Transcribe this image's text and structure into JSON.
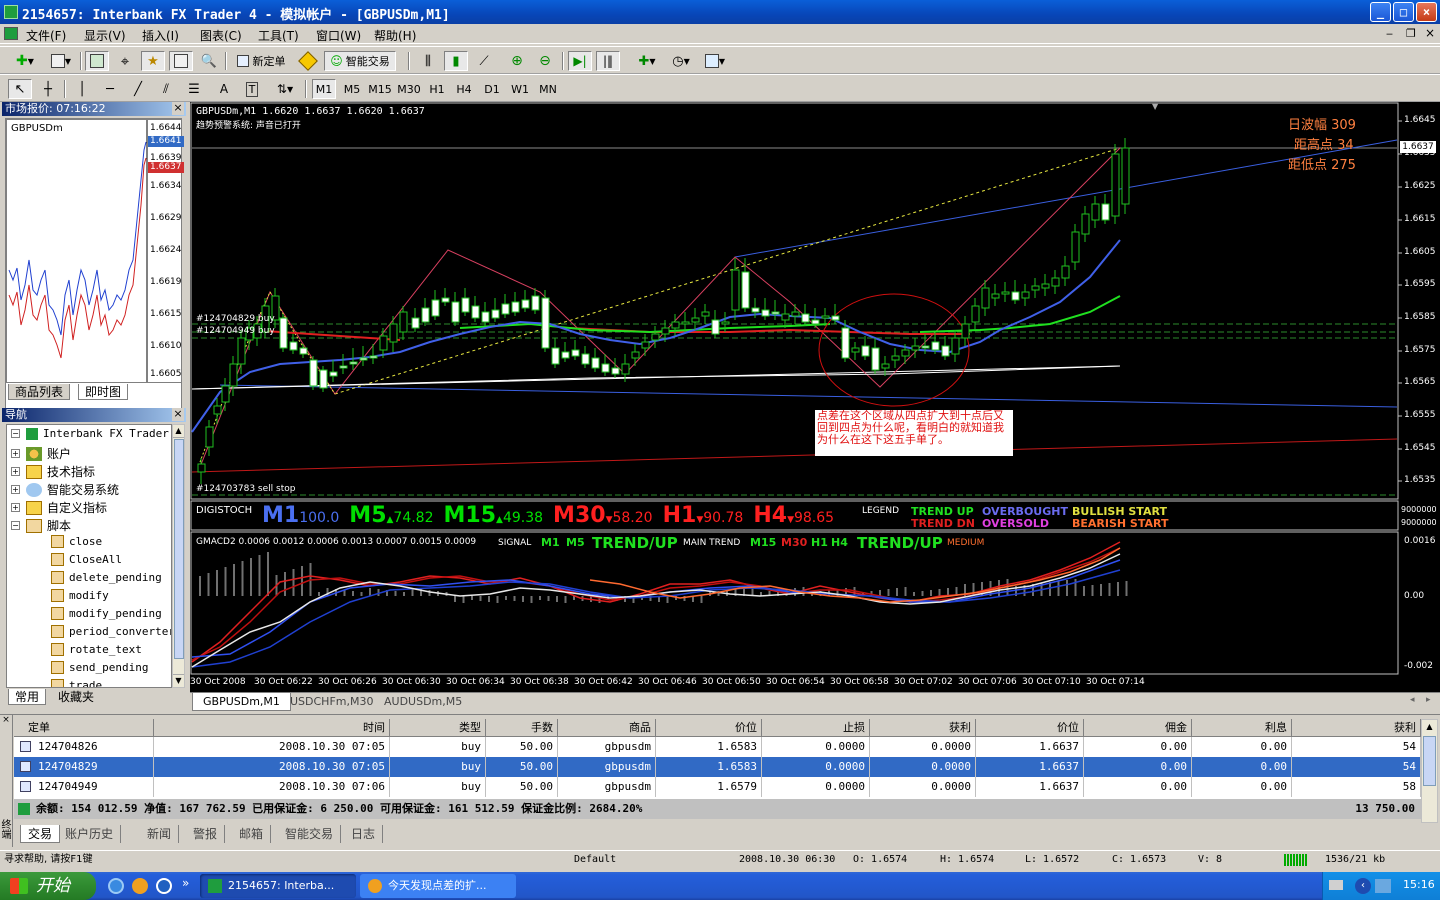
{
  "window": {
    "title": "2154657: Interbank FX Trader 4 - 模拟帐户 - [GBPUSDm,M1]",
    "buttons": [
      "_",
      "□",
      "×"
    ]
  },
  "menu": [
    "文件(F)",
    "显示(V)",
    "插入(I)",
    "图表(C)",
    "工具(T)",
    "窗口(W)",
    "帮助(H)"
  ],
  "toolbar1": {
    "new_order": "新定单",
    "expert_advisors": "智能交易"
  },
  "toolbar2": {
    "text_tool": "A",
    "timeframes": [
      "M1",
      "M5",
      "M15",
      "M30",
      "H1",
      "H4",
      "D1",
      "W1",
      "MN"
    ]
  },
  "market_watch": {
    "title": "市场报价: 07:16:22",
    "symbol": "GBPUSDm",
    "prices": [
      "1.6644",
      "1.6641",
      "1.6639",
      "1.6637",
      "1.6634",
      "1.6629",
      "1.6624",
      "1.6619",
      "1.6615",
      "1.6610",
      "1.6605"
    ],
    "tabs": [
      "商品列表",
      "即时图"
    ]
  },
  "navigator": {
    "title": "导航",
    "root": "Interbank FX Trader 4",
    "items": [
      "账户",
      "技术指标",
      "智能交易系统",
      "自定义指标",
      "脚本"
    ],
    "scripts": [
      "close",
      "CloseAll",
      "delete_pending",
      "modify",
      "modify_pending",
      "period_converter",
      "rotate_text",
      "send_pending",
      "trade"
    ],
    "tabs": [
      "常用",
      "收藏夹"
    ]
  },
  "chart": {
    "header": "GBPUSDm,M1  1.6620 1.6637 1.6620 1.6637",
    "subheader": "趋势预警系统: 声音已打开",
    "stats": [
      "日波幅 309",
      "距高点 34",
      "距低点 275"
    ],
    "current_price": "1.6637",
    "order_labels": [
      "#124704829 buy",
      "#124704949 buy",
      "#124703783 sell stop"
    ],
    "annotation": "点差在这个区域从四点扩大到十点后又回到四点为什么呢，看明白的就知道我为什么在这下这五手单了。",
    "price_axis": [
      "1.6645",
      "1.6635",
      "1.6625",
      "1.6615",
      "1.6605",
      "1.6595",
      "1.6585",
      "1.6575",
      "1.6565",
      "1.6555",
      "1.6545",
      "1.6535"
    ],
    "digistoch": {
      "label": "DIGISTOCH",
      "items": [
        {
          "tf": "M1",
          "val": "100.0",
          "arrow": "",
          "color": "#4a6ff0"
        },
        {
          "tf": "M5",
          "val": "74.82",
          "arrow": "▲",
          "color": "#00e000"
        },
        {
          "tf": "M15",
          "val": "49.38",
          "arrow": "▲",
          "color": "#00e000"
        },
        {
          "tf": "M30",
          "val": "58.20",
          "arrow": "▼",
          "color": "#ff2020"
        },
        {
          "tf": "H1",
          "val": "90.78",
          "arrow": "▼",
          "color": "#ff2020"
        },
        {
          "tf": "H4",
          "val": "98.65",
          "arrow": "▼",
          "color": "#ff2020"
        }
      ],
      "legend": "LEGEND",
      "legend_items": [
        "TREND UP",
        "TREND DN",
        "OVERBOUGHT",
        "OVERSOLD",
        "BULLISH START",
        "BEARISH START"
      ],
      "axis": [
        "9000000",
        "9000000"
      ]
    },
    "gmacd": {
      "label": "GMACD2 0.0006 0.0012 0.0006 0.0013 0.0007 0.0015 0.0009",
      "signal": "SIGNAL",
      "signal_tfs": [
        "M1",
        "M5"
      ],
      "signal_trend": "TREND/UP",
      "main_trend": "MAIN TREND",
      "main_tfs": [
        "M15",
        "M30",
        "H1",
        "H4"
      ],
      "main_trend_val": "TREND/UP",
      "strength": "MEDIUM",
      "axis": [
        "0.0016",
        "0.00",
        "-0.002"
      ]
    },
    "time_axis": [
      "30 Oct 2008",
      "30 Oct 06:22",
      "30 Oct 06:26",
      "30 Oct 06:30",
      "30 Oct 06:34",
      "30 Oct 06:38",
      "30 Oct 06:42",
      "30 Oct 06:46",
      "30 Oct 06:50",
      "30 Oct 06:54",
      "30 Oct 06:58",
      "30 Oct 07:02",
      "30 Oct 07:06",
      "30 Oct 07:10",
      "30 Oct 07:14"
    ],
    "tabs": [
      "GBPUSDm,M1",
      "USDCHFm,M30",
      "AUDUSDm,M5"
    ]
  },
  "terminal": {
    "columns": [
      "定单",
      "时间",
      "类型",
      "手数",
      "商品",
      "价位",
      "止损",
      "获利",
      "价位",
      "佣金",
      "利息",
      "获利"
    ],
    "rows": [
      [
        "124704826",
        "2008.10.30 07:05",
        "buy",
        "50.00",
        "gbpusdm",
        "1.6583",
        "0.0000",
        "0.0000",
        "1.6637",
        "0.00",
        "0.00",
        "54"
      ],
      [
        "124704829",
        "2008.10.30 07:05",
        "buy",
        "50.00",
        "gbpusdm",
        "1.6583",
        "0.0000",
        "0.0000",
        "1.6637",
        "0.00",
        "0.00",
        "54"
      ],
      [
        "124704949",
        "2008.10.30 07:06",
        "buy",
        "50.00",
        "gbpusdm",
        "1.6579",
        "0.0000",
        "0.0000",
        "1.6637",
        "0.00",
        "0.00",
        "58"
      ]
    ],
    "summary": "余额: 154 012.59  净值: 167 762.59  已用保证金: 6 250.00  可用保证金: 161 512.59  保证金比例: 2684.20%",
    "summary_profit": "13 750.00",
    "side_label": "终端",
    "tabs": [
      "交易",
      "账户历史",
      "新闻",
      "警报",
      "邮箱",
      "智能交易",
      "日志"
    ]
  },
  "statusbar": {
    "help": "寻求帮助, 请按F1键",
    "profile": "Default",
    "time": "2008.10.30 06:30",
    "open": "O: 1.6574",
    "high": "H: 1.6574",
    "low": "L: 1.6572",
    "close": "C: 1.6573",
    "volume": "V: 8",
    "traffic": "1536/21 kb"
  },
  "taskbar": {
    "start": "开始",
    "tasks": [
      "2154657: Interba...",
      "今天发现点差的扩..."
    ],
    "clock": "15:16"
  }
}
